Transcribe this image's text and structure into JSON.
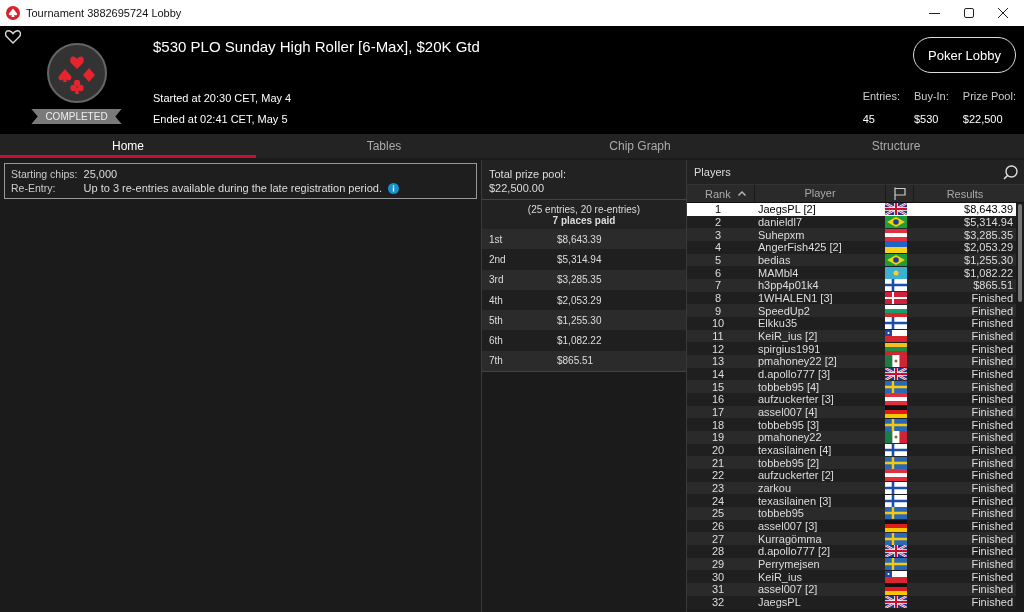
{
  "window": {
    "title": "Tournament 3882695724 Lobby"
  },
  "header": {
    "title": "$530 PLO Sunday High Roller [6-Max], $20K Gtd",
    "status": "COMPLETED",
    "started": "Started at 20:30 CET, May 4",
    "ended": "Ended at 02:41 CET, May 5",
    "button": "Poker Lobby",
    "stats": [
      {
        "label": "Entries:",
        "value": "45"
      },
      {
        "label": "Buy-In:",
        "value": "$530"
      },
      {
        "label": "Prize Pool:",
        "value": "$22,500"
      }
    ]
  },
  "tabs": [
    {
      "label": "Home",
      "selected": true
    },
    {
      "label": "Tables",
      "selected": false
    },
    {
      "label": "Chip Graph",
      "selected": false
    },
    {
      "label": "Structure",
      "selected": false
    }
  ],
  "info": [
    {
      "label": "Starting chips:",
      "value": "25,000",
      "info": false
    },
    {
      "label": "Re-Entry:",
      "value": "Up to 3 re-entries available during the late registration period.",
      "info": true
    }
  ],
  "prizes": {
    "total_label": "Total prize pool:",
    "total": "$22,500.00",
    "entries_note": "(25 entries, 20 re-entries)",
    "places_note": "7 places paid",
    "places": [
      {
        "place": "1st",
        "amount": "$8,643.39"
      },
      {
        "place": "2nd",
        "amount": "$5,314.94"
      },
      {
        "place": "3rd",
        "amount": "$3,285.35"
      },
      {
        "place": "4th",
        "amount": "$2,053.29"
      },
      {
        "place": "5th",
        "amount": "$1,255.30"
      },
      {
        "place": "6th",
        "amount": "$1,082.22"
      },
      {
        "place": "7th",
        "amount": "$865.51"
      }
    ]
  },
  "players": {
    "title": "Players",
    "columns": [
      "Rank",
      "Player",
      "Results"
    ],
    "rows": [
      {
        "rank": "1",
        "name": "JaegsPL [2]",
        "kind": "gb",
        "result": "$8,643.39",
        "selected": true
      },
      {
        "rank": "2",
        "name": "danieldl7",
        "kind": "br",
        "result": "$5,314.94",
        "selected": false
      },
      {
        "rank": "3",
        "name": "Suhepxm",
        "kind": "at",
        "result": "$3,285.35",
        "selected": false
      },
      {
        "rank": "4",
        "name": "AngerFish425 [2]",
        "kind": "ua",
        "result": "$2,053.29",
        "selected": false
      },
      {
        "rank": "5",
        "name": "bedias",
        "kind": "br",
        "result": "$1,255.30",
        "selected": false
      },
      {
        "rank": "6",
        "name": "MAMbl4",
        "kind": "kz",
        "result": "$1,082.22",
        "selected": false
      },
      {
        "rank": "7",
        "name": "h3pp4p01k4",
        "kind": "fi",
        "result": "$865.51",
        "selected": false
      },
      {
        "rank": "8",
        "name": "1WHALEN1 [3]",
        "kind": "dk",
        "result": "Finished",
        "selected": false
      },
      {
        "rank": "9",
        "name": "SpeedUp2",
        "kind": "bg",
        "result": "Finished",
        "selected": false
      },
      {
        "rank": "10",
        "name": "Elkku35",
        "kind": "fi",
        "result": "Finished",
        "selected": false
      },
      {
        "rank": "11",
        "name": "KeiR_ius [2]",
        "kind": "cl",
        "result": "Finished",
        "selected": false
      },
      {
        "rank": "12",
        "name": "spirgius1991",
        "kind": "lt",
        "result": "Finished",
        "selected": false
      },
      {
        "rank": "13",
        "name": "pmahoney22 [2]",
        "kind": "mx",
        "result": "Finished",
        "selected": false
      },
      {
        "rank": "14",
        "name": "d.apollo777 [3]",
        "kind": "gb",
        "result": "Finished",
        "selected": false
      },
      {
        "rank": "15",
        "name": "tobbeb95 [4]",
        "kind": "se",
        "result": "Finished",
        "selected": false
      },
      {
        "rank": "16",
        "name": "aufzuckerter [3]",
        "kind": "at",
        "result": "Finished",
        "selected": false
      },
      {
        "rank": "17",
        "name": "assel007 [4]",
        "kind": "de",
        "result": "Finished",
        "selected": false
      },
      {
        "rank": "18",
        "name": "tobbeb95 [3]",
        "kind": "se",
        "result": "Finished",
        "selected": false
      },
      {
        "rank": "19",
        "name": "pmahoney22",
        "kind": "mx",
        "result": "Finished",
        "selected": false
      },
      {
        "rank": "20",
        "name": "texasilainen [4]",
        "kind": "fi",
        "result": "Finished",
        "selected": false
      },
      {
        "rank": "21",
        "name": "tobbeb95 [2]",
        "kind": "se",
        "result": "Finished",
        "selected": false
      },
      {
        "rank": "22",
        "name": "aufzuckerter [2]",
        "kind": "at",
        "result": "Finished",
        "selected": false
      },
      {
        "rank": "23",
        "name": "zarkou",
        "kind": "fi",
        "result": "Finished",
        "selected": false
      },
      {
        "rank": "24",
        "name": "texasilainen [3]",
        "kind": "fi",
        "result": "Finished",
        "selected": false
      },
      {
        "rank": "25",
        "name": "tobbeb95",
        "kind": "se",
        "result": "Finished",
        "selected": false
      },
      {
        "rank": "26",
        "name": "assel007 [3]",
        "kind": "de",
        "result": "Finished",
        "selected": false
      },
      {
        "rank": "27",
        "name": "Kurragömma",
        "kind": "se",
        "result": "Finished",
        "selected": false
      },
      {
        "rank": "28",
        "name": "d.apollo777 [2]",
        "kind": "gb",
        "result": "Finished",
        "selected": false
      },
      {
        "rank": "29",
        "name": "Perrymejsen",
        "kind": "se",
        "result": "Finished",
        "selected": false
      },
      {
        "rank": "30",
        "name": "KeiR_ius",
        "kind": "cl",
        "result": "Finished",
        "selected": false
      },
      {
        "rank": "31",
        "name": "assel007 [2]",
        "kind": "de",
        "result": "Finished",
        "selected": false
      },
      {
        "rank": "32",
        "name": "JaegsPL",
        "kind": "gb",
        "result": "Finished",
        "selected": false
      }
    ]
  }
}
